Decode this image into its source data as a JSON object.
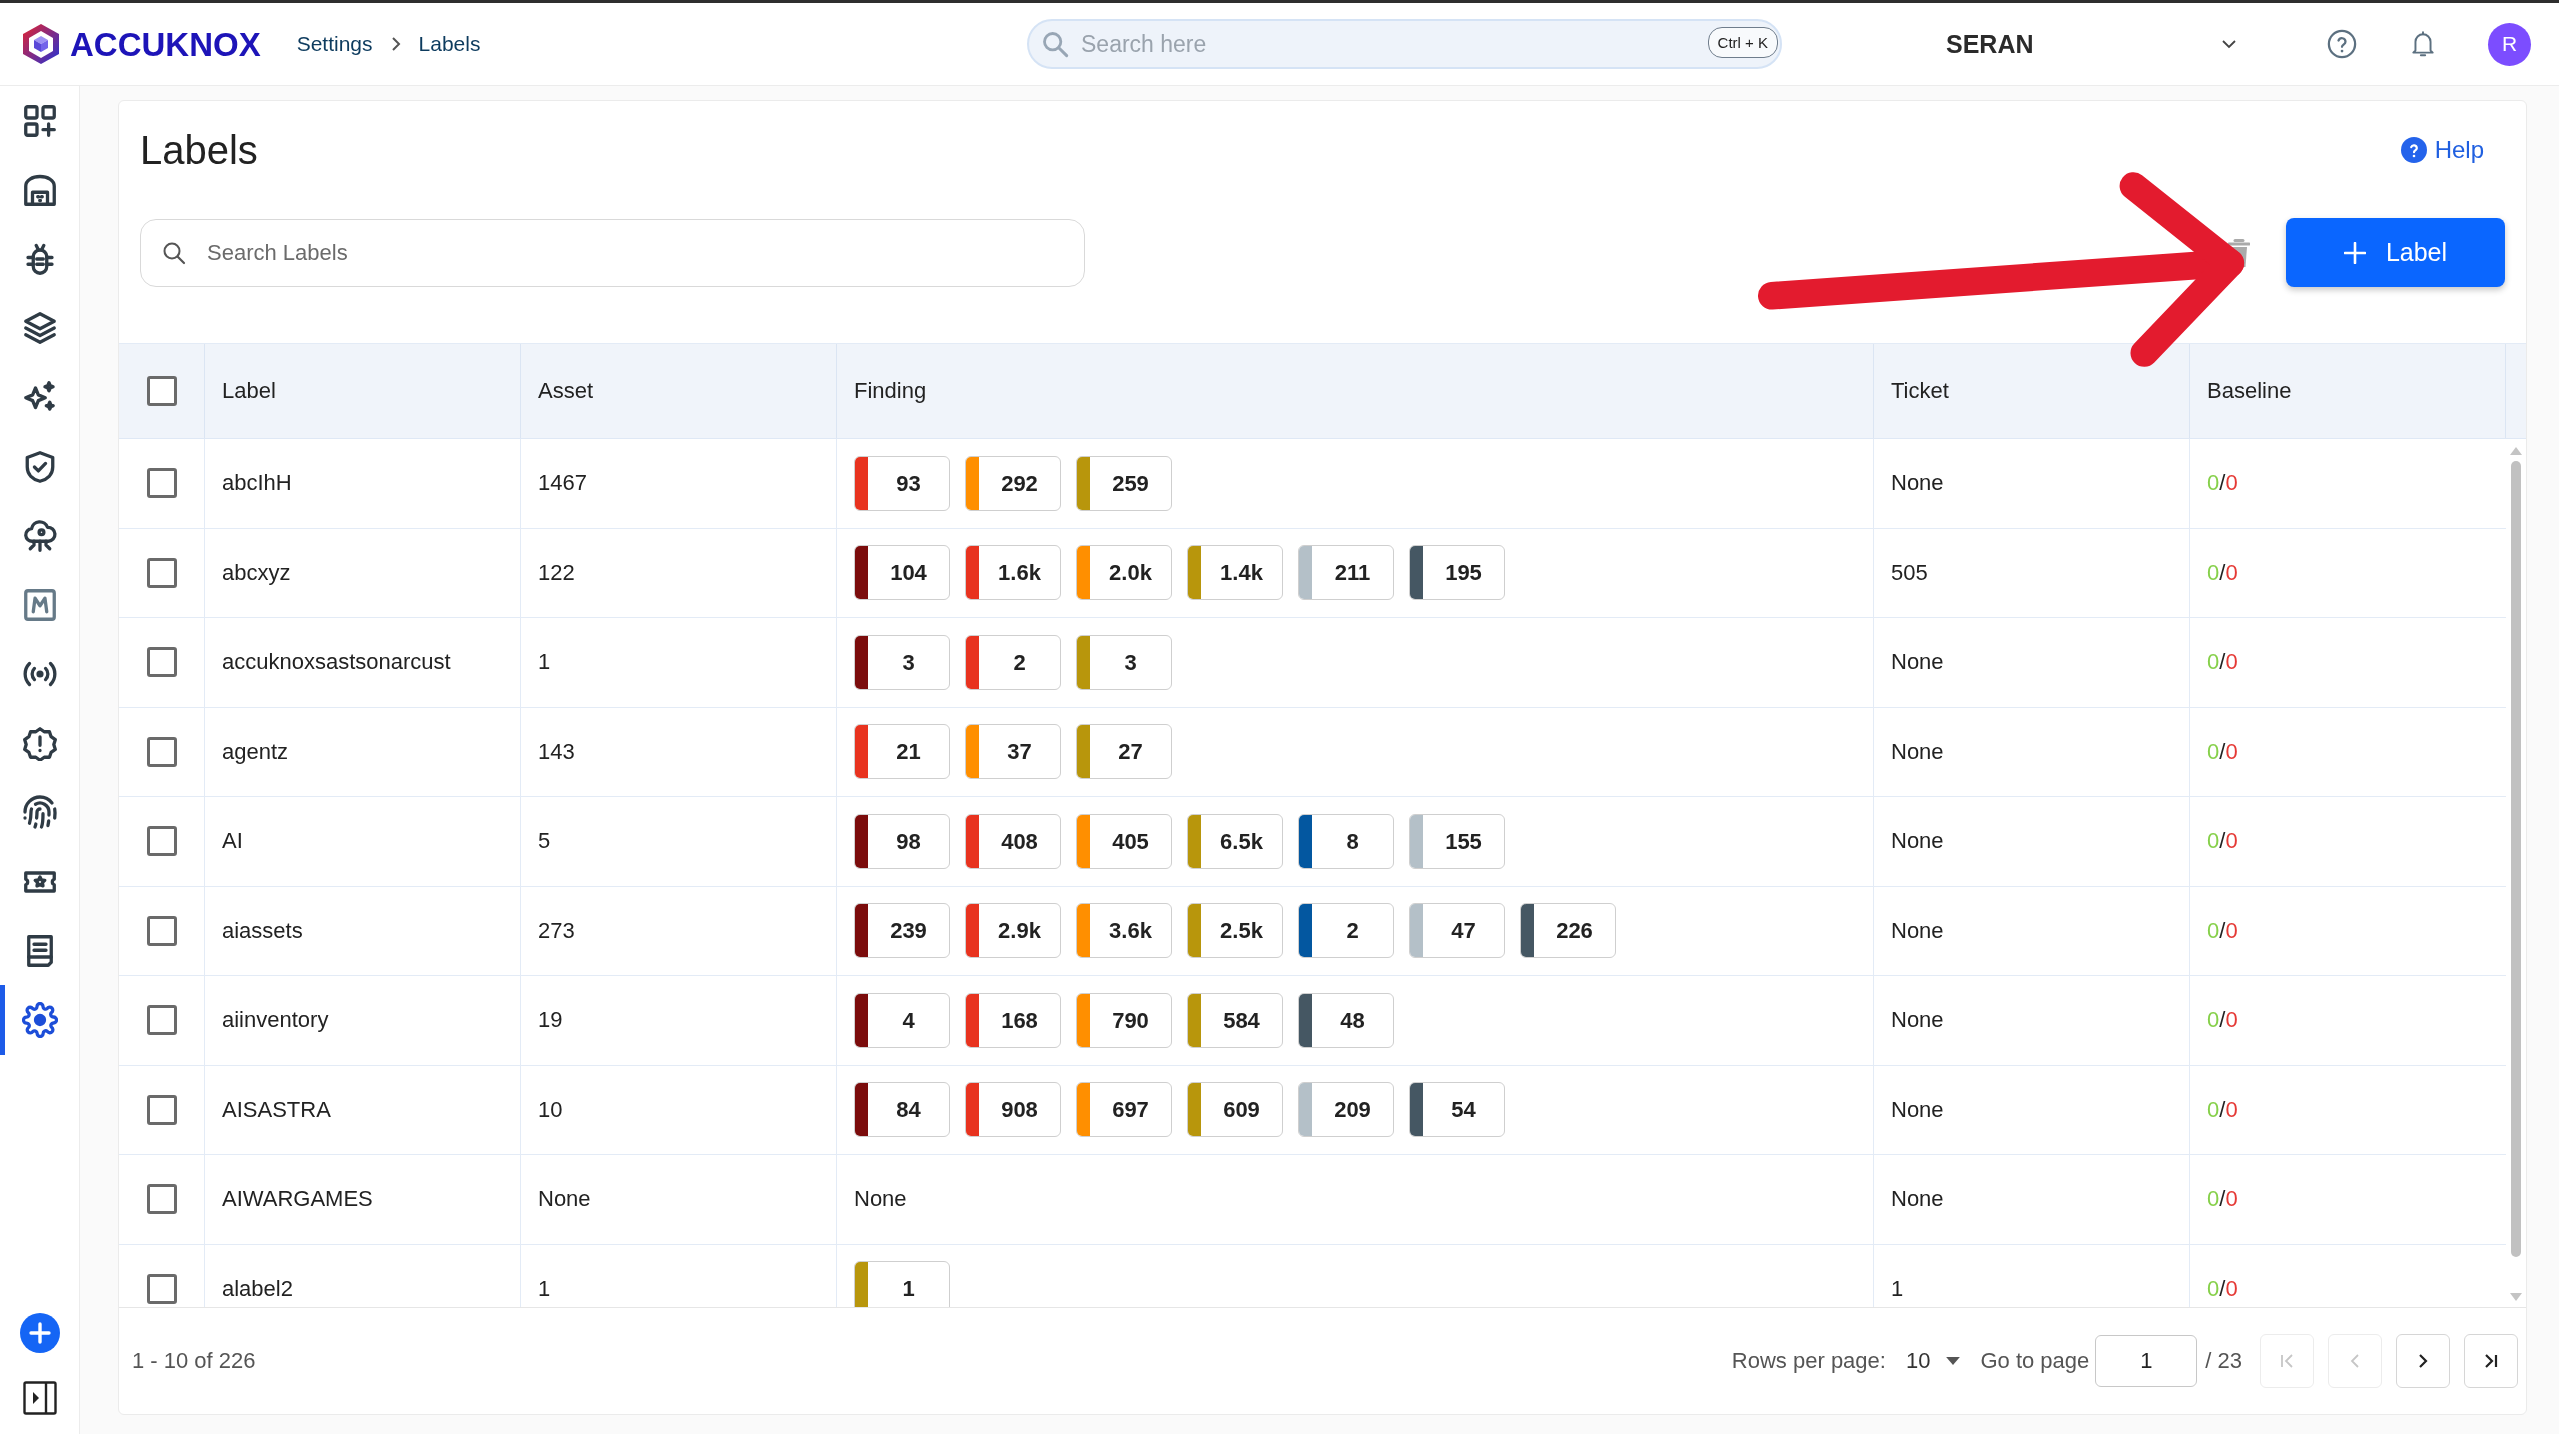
{
  "header": {
    "logo": "ACCUKNOX",
    "breadcrumb": [
      "Settings",
      "Labels"
    ],
    "search": {
      "placeholder": "Search here",
      "shortcut": "Ctrl + K"
    },
    "tenant": "SERAN",
    "avatar": "R"
  },
  "sidebar": {
    "items": [
      {
        "selected": false
      },
      {
        "selected": false
      },
      {
        "selected": false
      },
      {
        "selected": false
      },
      {
        "selected": false
      },
      {
        "selected": false
      },
      {
        "selected": false
      },
      {
        "selected": false
      },
      {
        "selected": false
      },
      {
        "selected": false
      },
      {
        "selected": false
      },
      {
        "selected": false
      },
      {
        "selected": false
      },
      {
        "selected": true
      }
    ]
  },
  "page": {
    "title": "Labels",
    "help": "Help",
    "search": {
      "placeholder": "Search Labels"
    },
    "add_button": "Label"
  },
  "table": {
    "all_checked": false,
    "columns": [
      "Label",
      "Asset",
      "Finding",
      "Ticket",
      "Baseline"
    ],
    "rows": [
      {
        "checked": false,
        "label": "abcIhH",
        "asset": "1467",
        "findings": [
          {
            "value": "93",
            "color": "#e8331f"
          },
          {
            "value": "292",
            "color": "#ff8f00"
          },
          {
            "value": "259",
            "color": "#b8960c"
          }
        ],
        "ticket": "None",
        "baseline": {
          "passed": "0",
          "separator": "/",
          "failed": "0"
        }
      },
      {
        "checked": false,
        "label": "abcxyz",
        "asset": "122",
        "findings": [
          {
            "value": "104",
            "color": "#7b0c0c"
          },
          {
            "value": "1.6k",
            "color": "#e8331f"
          },
          {
            "value": "2.0k",
            "color": "#ff8f00"
          },
          {
            "value": "1.4k",
            "color": "#b8960c"
          },
          {
            "value": "211",
            "color": "#b4c0c8"
          },
          {
            "value": "195",
            "color": "#455763"
          }
        ],
        "ticket": "505",
        "baseline": {
          "passed": "0",
          "separator": "/",
          "failed": "0"
        }
      },
      {
        "checked": false,
        "label": "accuknoxsastsonarcust",
        "asset": "1",
        "findings": [
          {
            "value": "3",
            "color": "#7b0c0c"
          },
          {
            "value": "2",
            "color": "#e8331f"
          },
          {
            "value": "3",
            "color": "#b8960c"
          }
        ],
        "ticket": "None",
        "baseline": {
          "passed": "0",
          "separator": "/",
          "failed": "0"
        }
      },
      {
        "checked": false,
        "label": "agentz",
        "asset": "143",
        "findings": [
          {
            "value": "21",
            "color": "#e8331f"
          },
          {
            "value": "37",
            "color": "#ff8f00"
          },
          {
            "value": "27",
            "color": "#b8960c"
          }
        ],
        "ticket": "None",
        "baseline": {
          "passed": "0",
          "separator": "/",
          "failed": "0"
        }
      },
      {
        "checked": false,
        "label": "AI",
        "asset": "5",
        "findings": [
          {
            "value": "98",
            "color": "#7b0c0c"
          },
          {
            "value": "408",
            "color": "#e8331f"
          },
          {
            "value": "405",
            "color": "#ff8f00"
          },
          {
            "value": "6.5k",
            "color": "#b8960c"
          },
          {
            "value": "8",
            "color": "#0357a0"
          },
          {
            "value": "155",
            "color": "#b4c0c8"
          }
        ],
        "ticket": "None",
        "baseline": {
          "passed": "0",
          "separator": "/",
          "failed": "0"
        }
      },
      {
        "checked": false,
        "label": "aiassets",
        "asset": "273",
        "findings": [
          {
            "value": "239",
            "color": "#7b0c0c"
          },
          {
            "value": "2.9k",
            "color": "#e8331f"
          },
          {
            "value": "3.6k",
            "color": "#ff8f00"
          },
          {
            "value": "2.5k",
            "color": "#b8960c"
          },
          {
            "value": "2",
            "color": "#0357a0"
          },
          {
            "value": "47",
            "color": "#b4c0c8"
          },
          {
            "value": "226",
            "color": "#455763"
          }
        ],
        "ticket": "None",
        "baseline": {
          "passed": "0",
          "separator": "/",
          "failed": "0"
        }
      },
      {
        "checked": false,
        "label": "aiinventory",
        "asset": "19",
        "findings": [
          {
            "value": "4",
            "color": "#7b0c0c"
          },
          {
            "value": "168",
            "color": "#e8331f"
          },
          {
            "value": "790",
            "color": "#ff8f00"
          },
          {
            "value": "584",
            "color": "#b8960c"
          },
          {
            "value": "48",
            "color": "#455763"
          }
        ],
        "ticket": "None",
        "baseline": {
          "passed": "0",
          "separator": "/",
          "failed": "0"
        }
      },
      {
        "checked": false,
        "label": "AISASTRA",
        "asset": "10",
        "findings": [
          {
            "value": "84",
            "color": "#7b0c0c"
          },
          {
            "value": "908",
            "color": "#e8331f"
          },
          {
            "value": "697",
            "color": "#ff8f00"
          },
          {
            "value": "609",
            "color": "#b8960c"
          },
          {
            "value": "209",
            "color": "#b4c0c8"
          },
          {
            "value": "54",
            "color": "#455763"
          }
        ],
        "ticket": "None",
        "baseline": {
          "passed": "0",
          "separator": "/",
          "failed": "0"
        }
      },
      {
        "checked": false,
        "label": "AIWARGAMES",
        "asset": "None",
        "findings_text": "None",
        "ticket": "None",
        "baseline": {
          "passed": "0",
          "separator": "/",
          "failed": "0"
        }
      },
      {
        "checked": false,
        "label": "alabel2",
        "asset": "1",
        "findings": [
          {
            "value": "1",
            "color": "#b8960c"
          }
        ],
        "ticket": "1",
        "baseline": {
          "passed": "0",
          "separator": "/",
          "failed": "0"
        }
      }
    ]
  },
  "footer": {
    "range": "1 - 10 of 226",
    "rows_per_page_label": "Rows per page:",
    "rows_per_page": "10",
    "go_to_label": "Go to page",
    "page": "1",
    "page_total": "/ 23",
    "pager": [
      {
        "kind": "first",
        "disabled": true
      },
      {
        "kind": "prev",
        "disabled": true
      },
      {
        "kind": "next",
        "disabled": false
      },
      {
        "kind": "last",
        "disabled": false
      }
    ]
  }
}
